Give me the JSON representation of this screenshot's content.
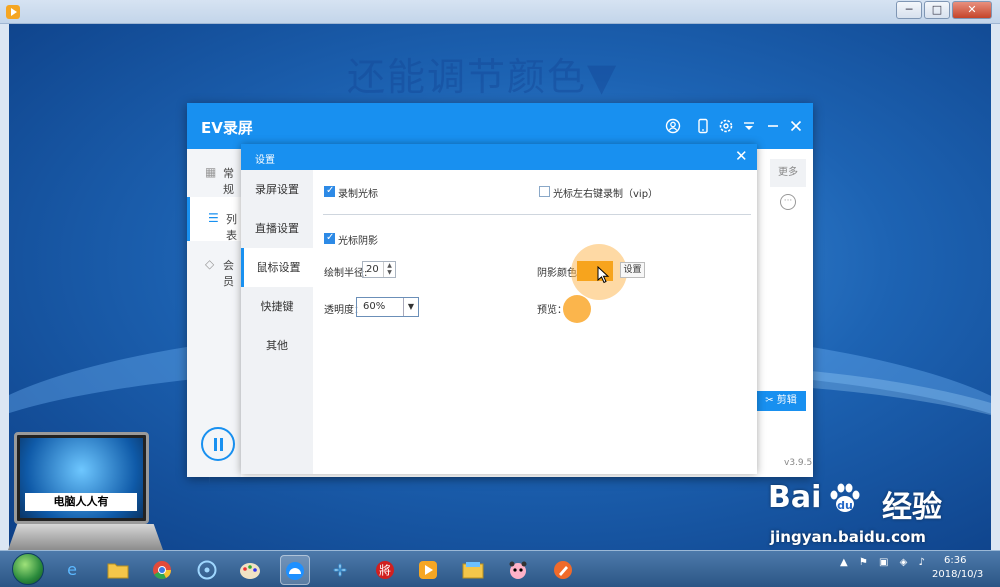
{
  "caption": "还能调节颜色▼",
  "player": {
    "minimize": "─",
    "maximize": "□",
    "close": "✕"
  },
  "ev": {
    "title": "EV录屏",
    "sidebar": [
      {
        "icon": "grid-icon",
        "label": "常规"
      },
      {
        "icon": "list-icon",
        "label": "列表"
      },
      {
        "icon": "diamond-icon",
        "label": "会员"
      }
    ],
    "more_label": "更多",
    "edit_label": "剪辑",
    "version": "v3.9.5"
  },
  "settings": {
    "title": "设置",
    "nav": [
      "录屏设置",
      "直播设置",
      "鼠标设置",
      "快捷键",
      "其他"
    ],
    "active_nav": "鼠标设置",
    "record_cursor": {
      "label": "录制光标",
      "checked": true
    },
    "record_clicks": {
      "label": "光标左右键录制（vip）",
      "checked": false
    },
    "cursor_shadow": {
      "label": "光标阴影",
      "checked": true
    },
    "radius": {
      "label": "绘制半径:",
      "value": "20"
    },
    "opacity": {
      "label": "透明度：",
      "value": "60%"
    },
    "shadow_color": {
      "label": "阴影颜色:",
      "color": "#f7a41d",
      "button": "设置"
    },
    "preview": {
      "label": "预览："
    }
  },
  "taskbar": {
    "time": "6:36",
    "date": "2018/10/3",
    "apps": [
      "ie-icon",
      "folder-icon",
      "chrome-icon",
      "media-icon",
      "paint-icon",
      "ev-icon",
      "fan-icon",
      "chess-icon",
      "player-icon",
      "explorer-icon",
      "panda-icon",
      "brush-icon"
    ]
  },
  "watermark": {
    "laptop_label": "电脑人人有",
    "baidu_logo": "Bai",
    "baidu_du": "du",
    "baidu_jingyan": "经验",
    "baidu_url": "jingyan.baidu.com"
  }
}
